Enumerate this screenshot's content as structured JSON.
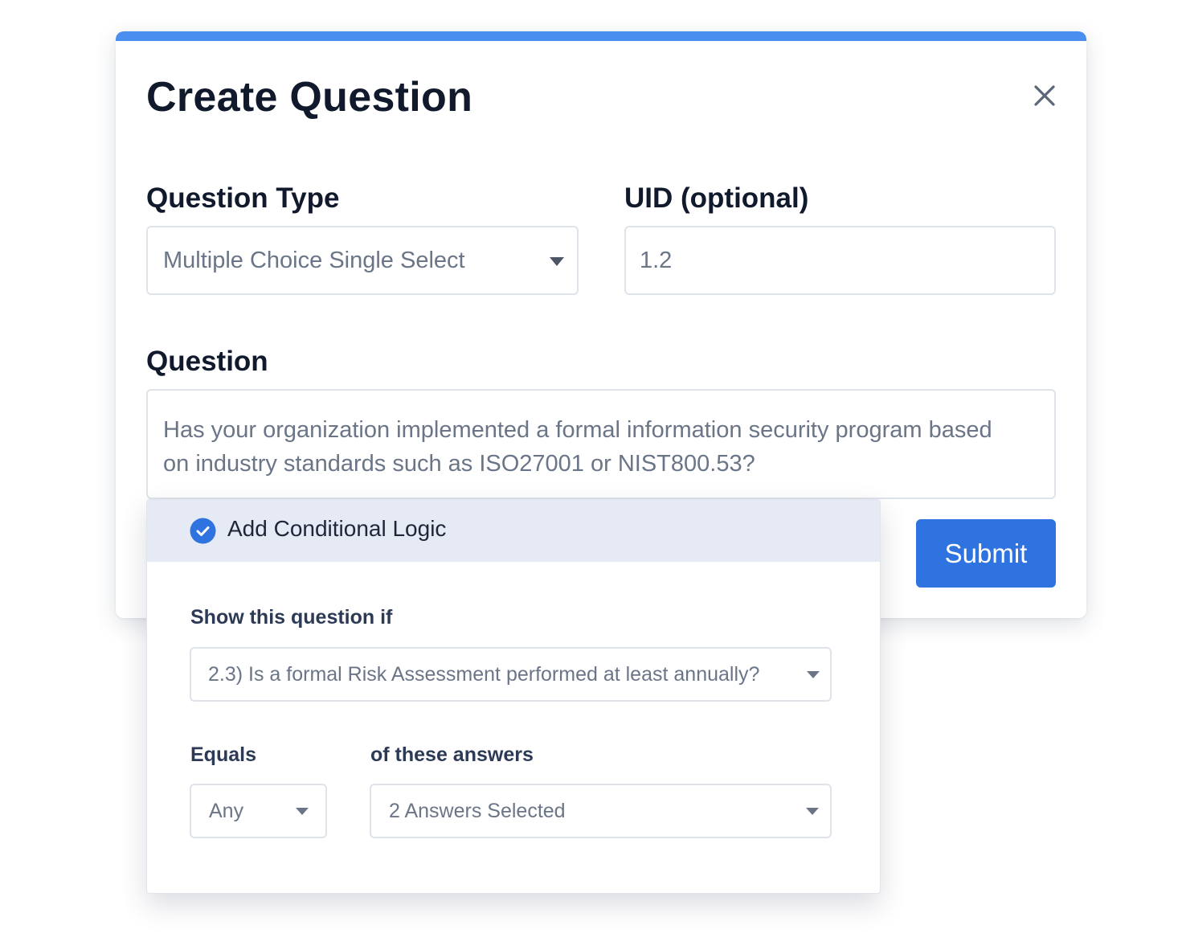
{
  "modal": {
    "title": "Create Question",
    "close_label": "×",
    "accent_color": "#4a8ef0"
  },
  "question_type": {
    "label": "Question Type",
    "selected": "Multiple Choice Single Select"
  },
  "uid": {
    "label": "UID (optional)",
    "value": "1.2"
  },
  "question": {
    "label": "Question",
    "value": "Has your organization implemented a formal information security program based on industry standards such as ISO27001 or NIST800.53?"
  },
  "submit": {
    "label": "Submit",
    "color": "#2f73e0"
  },
  "conditional_logic": {
    "title": "Add Conditional Logic",
    "checked": true,
    "show_if_label": "Show this question if",
    "show_if_selected": "2.3) Is a formal Risk Assessment performed at least annually?",
    "equals_label": "Equals",
    "equals_selected": "Any",
    "answers_label": "of these answers",
    "answers_selected": "2 Answers Selected"
  },
  "icons": [
    "close-icon",
    "check-circle-icon",
    "chevron-down-icon"
  ]
}
